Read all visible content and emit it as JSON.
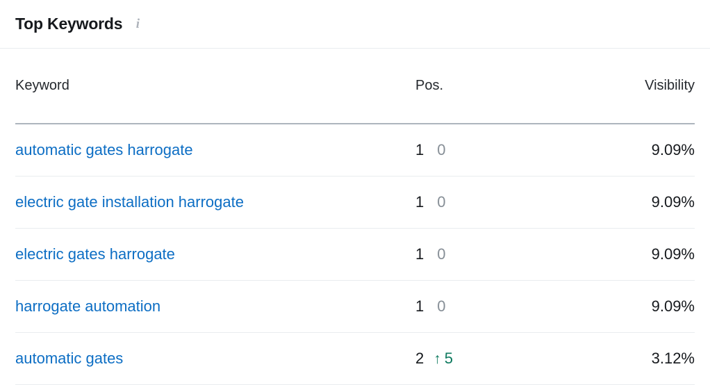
{
  "card": {
    "title": "Top Keywords",
    "info_icon": "info-icon"
  },
  "colors": {
    "link": "#0d6ec4",
    "text": "#16191d",
    "muted": "#868e96",
    "up": "#0e7a5f",
    "down": "#c92a2a",
    "header_rule": "#adb5bd",
    "row_rule": "#e9ecef",
    "background": "#ffffff"
  },
  "table": {
    "columns": [
      {
        "label": "Keyword",
        "align": "left"
      },
      {
        "label": "Pos.",
        "align": "left"
      },
      {
        "label": "Visibility",
        "align": "right"
      }
    ],
    "rows": [
      {
        "keyword": "automatic gates harrogate",
        "position": "1",
        "delta": "0",
        "delta_direction": "neutral",
        "delta_arrow": "",
        "visibility": "9.09%"
      },
      {
        "keyword": "electric gate installation harrogate",
        "position": "1",
        "delta": "0",
        "delta_direction": "neutral",
        "delta_arrow": "",
        "visibility": "9.09%"
      },
      {
        "keyword": "electric gates harrogate",
        "position": "1",
        "delta": "0",
        "delta_direction": "neutral",
        "delta_arrow": "",
        "visibility": "9.09%"
      },
      {
        "keyword": "harrogate automation",
        "position": "1",
        "delta": "0",
        "delta_direction": "neutral",
        "delta_arrow": "",
        "visibility": "9.09%"
      },
      {
        "keyword": "automatic gates",
        "position": "2",
        "delta": "5",
        "delta_direction": "up",
        "delta_arrow": "↑",
        "visibility": "3.12%"
      }
    ]
  }
}
